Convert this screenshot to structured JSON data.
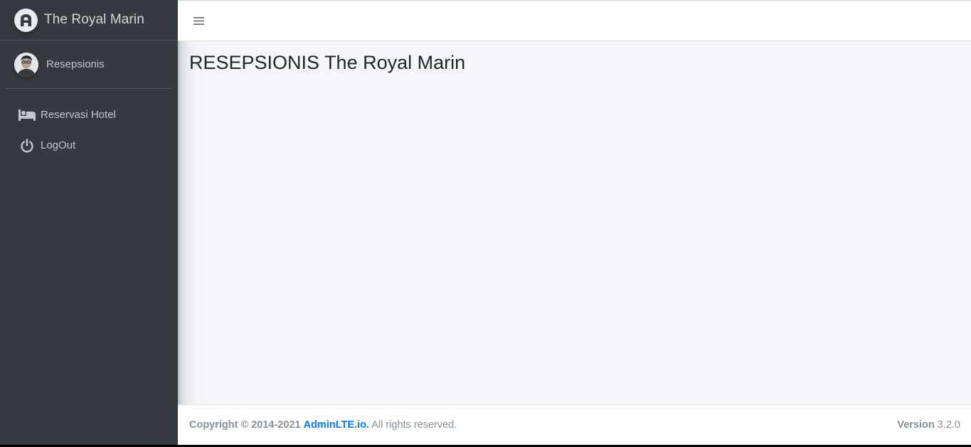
{
  "brand": {
    "name": "The Royal Marin",
    "logo_icon": "adminlte-logo-icon"
  },
  "user": {
    "name": "Resepsionis",
    "avatar_icon": "user-avatar-icon"
  },
  "nav": {
    "items": [
      {
        "label": "Reservasi Hotel",
        "icon": "bed-icon"
      },
      {
        "label": "LogOut",
        "icon": "power-icon"
      }
    ]
  },
  "header": {
    "toggle_icon": "hamburger-icon"
  },
  "main": {
    "title": "RESEPSIONIS The Royal Marin"
  },
  "footer": {
    "copyright": "Copyright © 2014-2021",
    "link": "AdminLTE.io.",
    "rights": "All rights reserved.",
    "version_label": "Version",
    "version_value": "3.2.0"
  },
  "colors": {
    "sidebar_bg": "#343a40",
    "content_bg": "#f4f6f9",
    "link": "#007bff"
  }
}
